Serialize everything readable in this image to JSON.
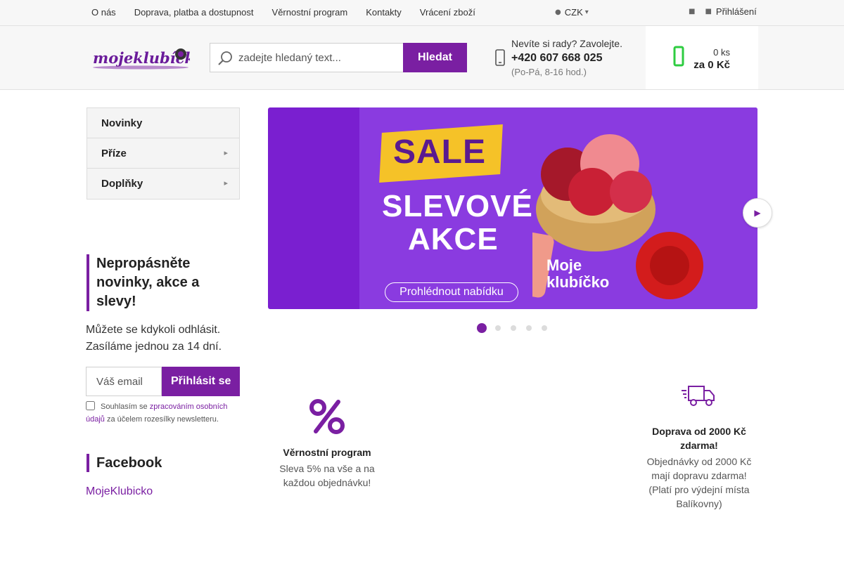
{
  "topnav": {
    "links": [
      "O nás",
      "Doprava, platba a dostupnost",
      "Věrnostní program",
      "Kontakty",
      "Vrácení zboží"
    ],
    "currency": "CZK",
    "login_label": "Přihlášení"
  },
  "header": {
    "logo_text": "mojeklubicko",
    "search_placeholder": "zadejte hledaný text...",
    "search_button": "Hledat",
    "help_question": "Nevíte si rady? Zavolejte.",
    "phone": "+420 607 668 025",
    "hours": "(Po-Pá, 8-16 hod.)",
    "cart_count": "0 ks",
    "cart_total": "za 0 Kč"
  },
  "sidebar": {
    "categories": [
      {
        "label": "Novinky",
        "has_children": false
      },
      {
        "label": "Příze",
        "has_children": true
      },
      {
        "label": "Doplňky",
        "has_children": true
      }
    ],
    "newsletter_title": "Nepropásněte novinky, akce a slevy!",
    "newsletter_text": "Můžete se kdykoli odhlásit. Zasíláme jednou za 14 dní.",
    "email_placeholder": "Váš email",
    "subscribe_button": "Přihlásit se",
    "consent_prefix": "Souhlasím se",
    "consent_link": "zpracováním osobních údajů",
    "consent_suffix": "za účelem rozesílky newsletteru.",
    "facebook_title": "Facebook",
    "facebook_link": "MojeKlubicko"
  },
  "banner": {
    "sale": "SALE",
    "headline_1": "SLEVOVÉ",
    "headline_2": "AKCE",
    "cta": "Prohlédnout nabídku",
    "brand_1": "Moje",
    "brand_2": "klubíčko",
    "slide_count": 5,
    "active_slide": 1,
    "colors": {
      "purple": "#7a1fd0",
      "yellow": "#f5c228"
    }
  },
  "benefits": [
    {
      "icon": "percent-icon",
      "title": "Věrnostní program",
      "text": "Sleva 5% na vše a na každou objednávku!"
    },
    {
      "icon": "delivery-truck-icon",
      "title": "Doprava od 2000 Kč zdarma!",
      "text": "Objednávky od 2000 Kč mají dopravu zdarma! (Platí pro výdejní místa Balíkovny)"
    }
  ],
  "colors": {
    "accent": "#7a1fa2",
    "cart_icon": "#2ecc40"
  }
}
